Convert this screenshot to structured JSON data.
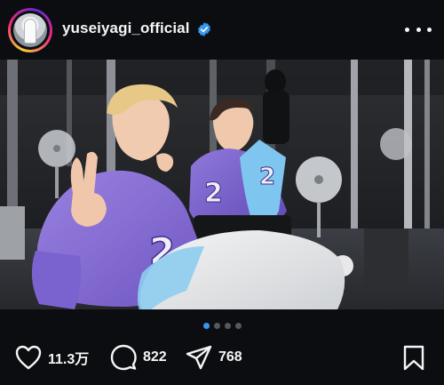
{
  "post": {
    "username": "yuseiyagi_official",
    "verified": true,
    "avatar": "profile-photo",
    "more_icon": "more-horizontal-icon"
  },
  "media": {
    "description_icon": "photo-two-people-in-purple-jerseys",
    "jersey_number": "2",
    "carousel": {
      "total": 4,
      "current": 1
    }
  },
  "actions": {
    "likes": "11.3万",
    "comments": "822",
    "shares": "768",
    "icons": [
      "heart-icon",
      "comment-icon",
      "share-icon",
      "bookmark-icon"
    ]
  },
  "colors": {
    "background": "#0b0d10",
    "accent": "#3797f0",
    "jersey": "#8a6fd6",
    "text": "#f5f5f5"
  }
}
